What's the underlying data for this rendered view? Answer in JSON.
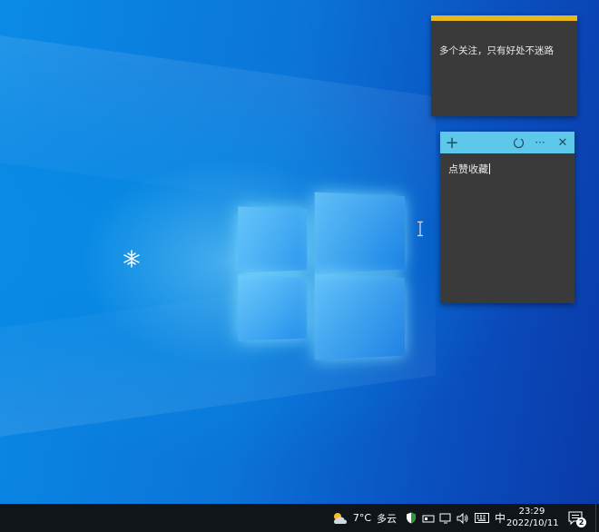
{
  "notes": [
    {
      "text": "多个关注，只有好处不迷路",
      "accent_color": "#e8b81a"
    },
    {
      "text": "点赞收藏",
      "toolbar_color": "#5ec8ea"
    }
  ],
  "note_toolbar": {
    "add_label": "+",
    "menu_label": "···",
    "close_label": "✕"
  },
  "taskbar": {
    "weather_temp": "7°C",
    "weather_desc": "多云",
    "ime_label": "中",
    "time": "23:29",
    "date": "2022/10/11",
    "notification_count": "2",
    "tray_icons": [
      "weather-icon",
      "security-shield-icon",
      "wifi-icon",
      "display-icon",
      "volume-icon",
      "keyboard-icon",
      "notification-icon"
    ]
  }
}
